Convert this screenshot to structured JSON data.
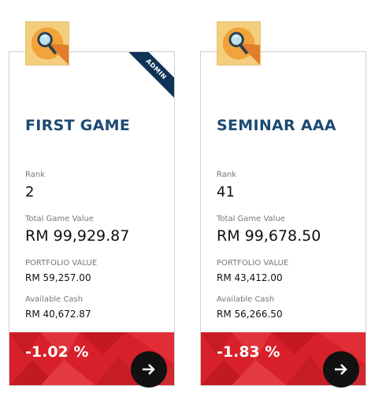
{
  "cards": [
    {
      "badge": "ADMIN",
      "title": "FIRST GAME",
      "rank_label": "Rank",
      "rank": "2",
      "total_game_value_label": "Total Game Value",
      "total_game_value": "RM 99,929.87",
      "portfolio_value_label": "PORTFOLIO VALUE",
      "portfolio_value": "RM 59,257.00",
      "available_cash_label": "Available Cash",
      "available_cash": "RM 40,672.87",
      "change": "-1.02 %"
    },
    {
      "title": "SEMINAR AAA",
      "rank_label": "Rank",
      "rank": "41",
      "total_game_value_label": "Total Game Value",
      "total_game_value": "RM 99,678.50",
      "portfolio_value_label": "PORTFOLIO VALUE",
      "portfolio_value": "RM 43,412.00",
      "available_cash_label": "Available Cash",
      "available_cash": "RM 56,266.50",
      "change": "-1.83 %"
    }
  ],
  "icons": {
    "card_icon": "magnifier-icon",
    "go": "arrow-right-icon"
  },
  "colors": {
    "title": "#1c4a73",
    "badge": "#0f3356",
    "footer": "#d8202a",
    "icon_bg": "#f4ce7c"
  }
}
